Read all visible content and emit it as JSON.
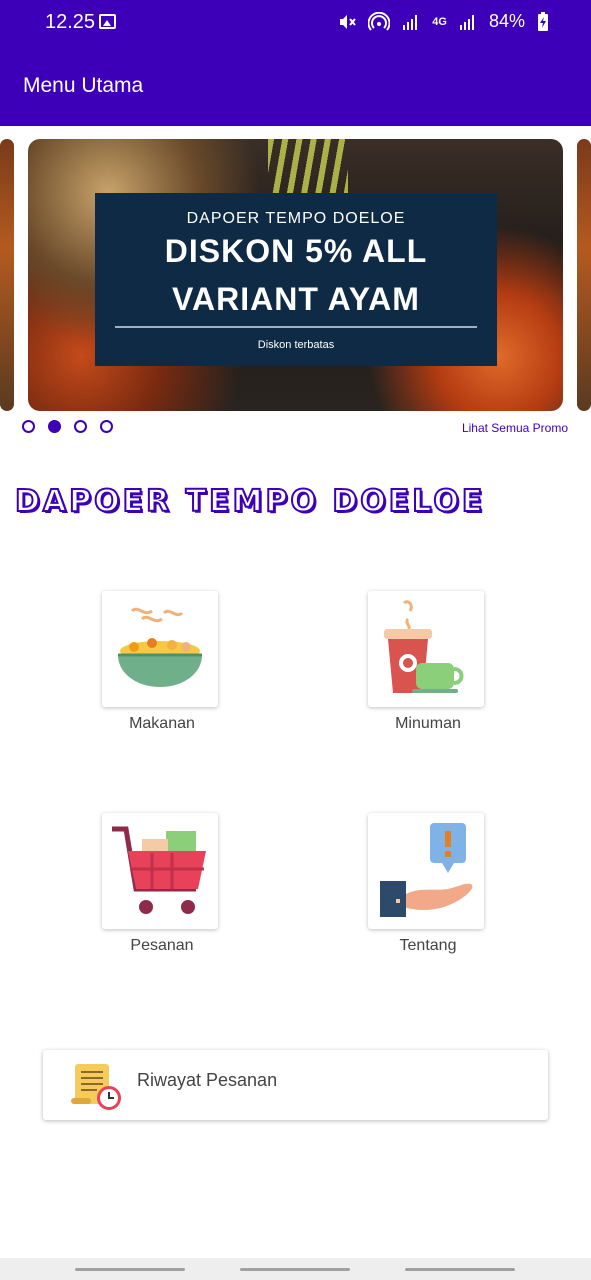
{
  "status_bar": {
    "time": "12.25",
    "network": "4G",
    "battery": "84%",
    "icons": [
      "gallery-icon",
      "mute-icon",
      "hotspot-icon",
      "signal-icon",
      "battery-icon"
    ]
  },
  "app_bar": {
    "title": "Menu Utama"
  },
  "promo": {
    "brand": "DAPOER TEMPO DOELOE",
    "headline_1": "DISKON 5% ALL",
    "headline_2": "VARIANT AYAM",
    "note": "Diskon terbatas",
    "dots": 4,
    "active_dot": 2,
    "see_all": "Lihat Semua Promo"
  },
  "brand_title": "DAPOER TEMPO DOELOE",
  "menu": [
    {
      "label": "Makanan",
      "icon": "food-bowl-icon"
    },
    {
      "label": "Minuman",
      "icon": "drink-cup-icon"
    },
    {
      "label": "Pesanan",
      "icon": "shopping-cart-icon"
    },
    {
      "label": "Tentang",
      "icon": "info-hand-icon"
    }
  ],
  "history": {
    "label": "Riwayat Pesanan",
    "icon": "receipt-clock-icon"
  },
  "colors": {
    "primary": "#3d00b8",
    "banner": "#0e2a44"
  }
}
